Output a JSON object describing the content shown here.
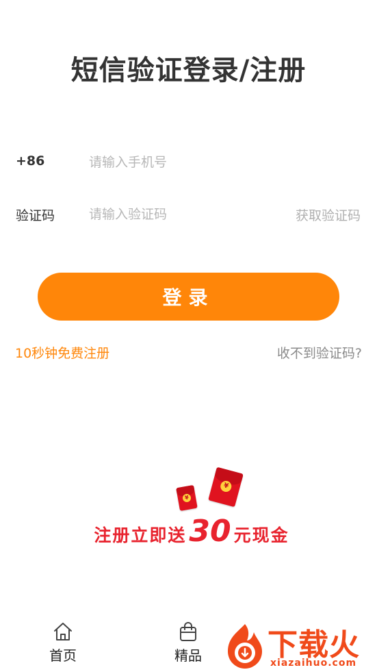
{
  "header": {
    "title": "短信验证登录/注册"
  },
  "phone": {
    "prefix": "+86",
    "placeholder": "请输入手机号",
    "value": ""
  },
  "code": {
    "label": "验证码",
    "placeholder": "请输入验证码",
    "value": "",
    "get_code_label": "获取验证码"
  },
  "login": {
    "label": "登录"
  },
  "links": {
    "register": "10秒钟免费注册",
    "no_code": "收不到验证码?"
  },
  "promo": {
    "pre": "注册立即送",
    "amount": "30",
    "post": "元现金",
    "envelope_symbol": "¥"
  },
  "tabs": [
    {
      "label": "首页",
      "icon": "home-icon"
    },
    {
      "label": "精品",
      "icon": "bag-icon"
    }
  ],
  "watermark": {
    "text": "下载火",
    "sub": "xiazaihuo.com"
  },
  "colors": {
    "accent": "#ff8609",
    "promo_red": "#e8232e",
    "watermark": "#f04a1a"
  }
}
